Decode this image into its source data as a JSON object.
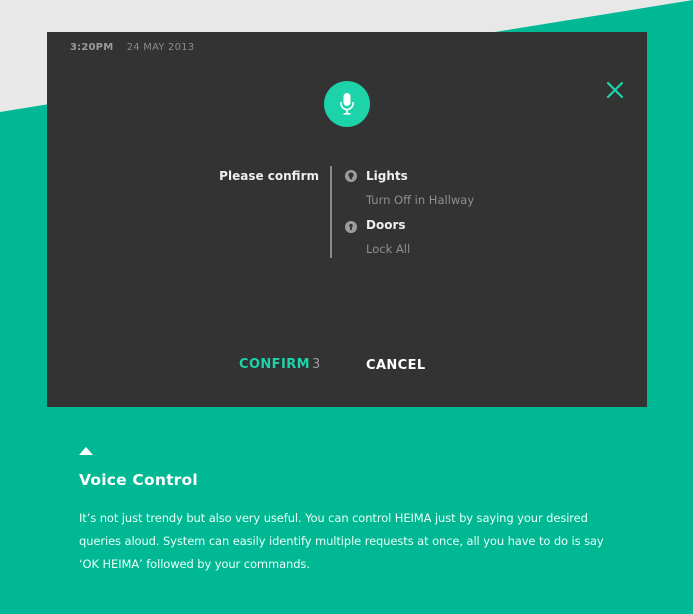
{
  "colors": {
    "background": "#00b894",
    "top_band": "#e8e8e8",
    "panel": "#333333",
    "accent": "#1dd3aa"
  },
  "panel": {
    "time": "3:20PM",
    "date": "24 MAY 2013",
    "prompt": "Please confirm",
    "items": [
      {
        "icon": "bulb-icon",
        "title": "Lights",
        "action": "Turn Off in Hallway"
      },
      {
        "icon": "keyhole-icon",
        "title": "Doors",
        "action": "Lock All"
      }
    ],
    "confirm_label": "CONFIRM",
    "countdown": "3",
    "cancel_label": "CANCEL"
  },
  "feature": {
    "title": "Voice Control",
    "description": "It’s not just trendy but also very useful. You can control HEIMA just by saying your desired queries aloud. System can easily identify multiple requests at once, all you have to do is say ‘OK HEIMA’ followed by your commands."
  }
}
